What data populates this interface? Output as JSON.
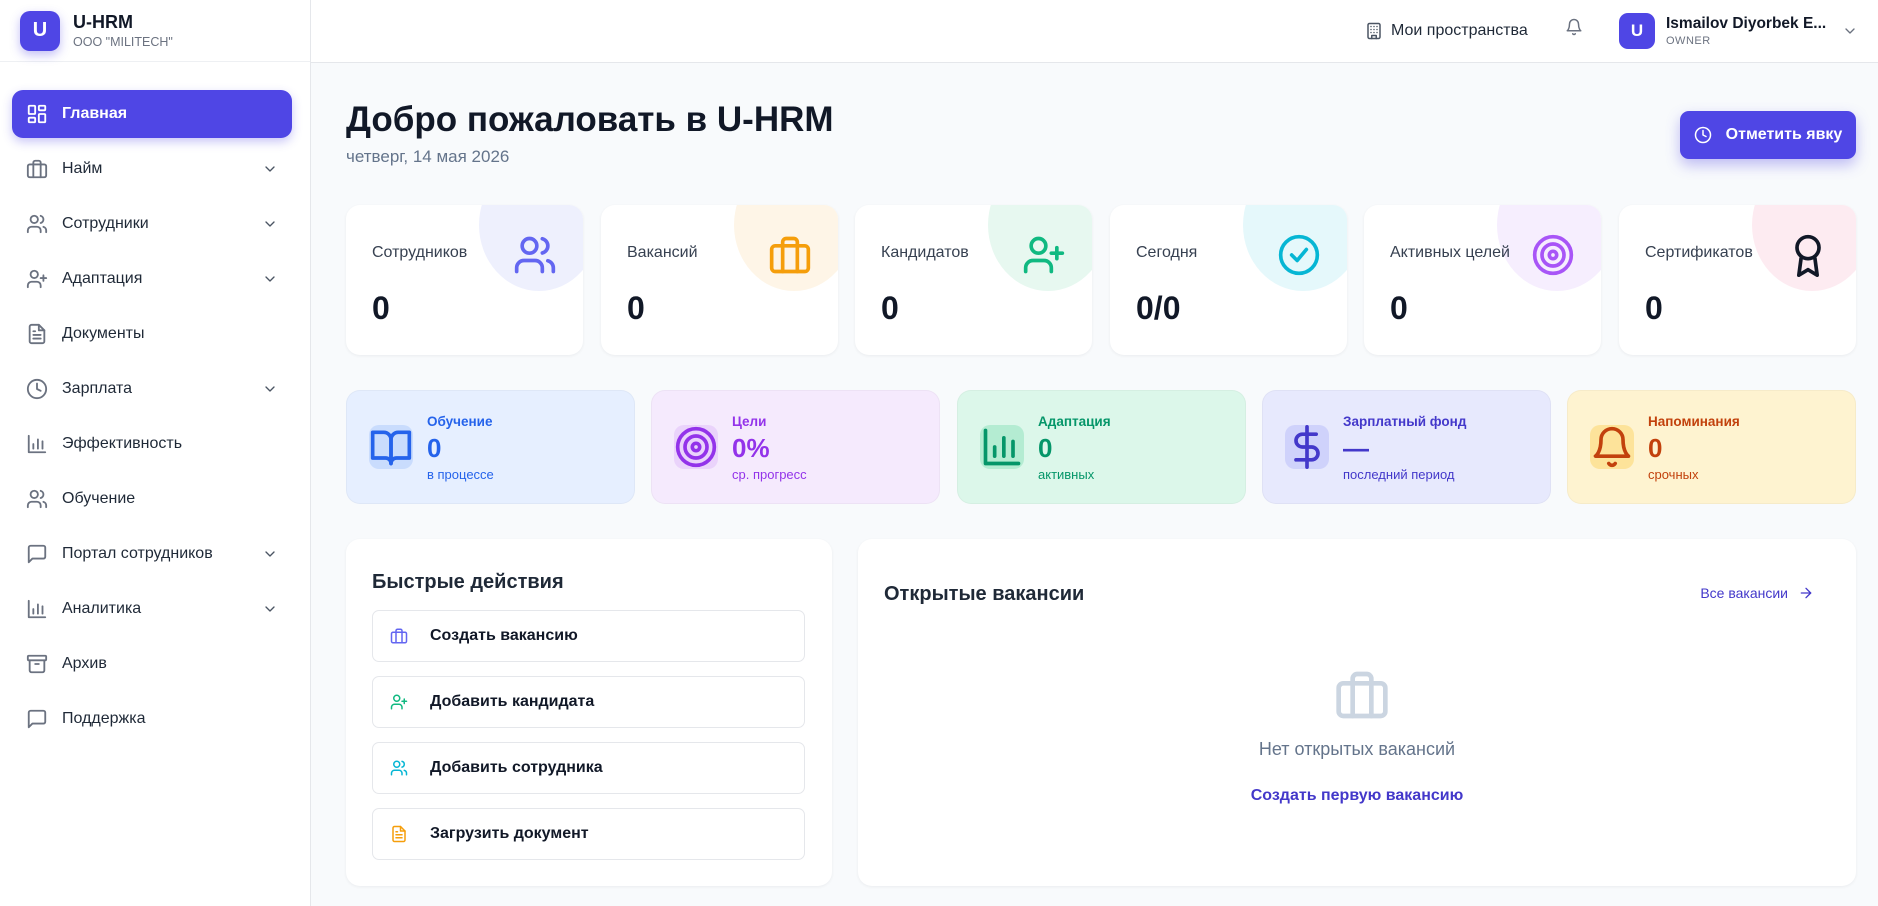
{
  "brand": {
    "logo_letter": "U",
    "name": "U-HRM",
    "org": "ООО \"MILITECH\""
  },
  "sidebar": {
    "items": [
      {
        "label": "Главная",
        "icon": "dashboard-icon",
        "active": true,
        "expandable": false
      },
      {
        "label": "Найм",
        "icon": "briefcase-icon",
        "expandable": true
      },
      {
        "label": "Сотрудники",
        "icon": "users-icon",
        "expandable": true
      },
      {
        "label": "Адаптация",
        "icon": "user-plus-icon",
        "expandable": true
      },
      {
        "label": "Документы",
        "icon": "document-icon",
        "expandable": false
      },
      {
        "label": "Зарплата",
        "icon": "clock-icon",
        "expandable": true
      },
      {
        "label": "Эффективность",
        "icon": "bar-chart-icon",
        "expandable": false
      },
      {
        "label": "Обучение",
        "icon": "users-icon",
        "expandable": false
      },
      {
        "label": "Портал сотрудников",
        "icon": "message-icon",
        "expandable": true
      },
      {
        "label": "Аналитика",
        "icon": "bar-chart-icon",
        "expandable": true
      },
      {
        "label": "Архив",
        "icon": "archive-icon",
        "expandable": false
      },
      {
        "label": "Поддержка",
        "icon": "message-icon",
        "expandable": false
      }
    ]
  },
  "header": {
    "spaces_label": "Мои пространства",
    "user": {
      "avatar_letter": "U",
      "name": "Ismailov Diyorbek E...",
      "role": "OWNER"
    }
  },
  "hero": {
    "title": "Добро пожаловать в U-HRM",
    "date": "четверг, 14 мая 2026",
    "mark_button": "Отметить явку"
  },
  "stats": [
    {
      "label": "Сотрудников",
      "value": "0",
      "icon": "users-icon",
      "color": "#6366f1",
      "tint": "#eef0fd"
    },
    {
      "label": "Вакансий",
      "value": "0",
      "icon": "briefcase-icon",
      "color": "#f59e0b",
      "tint": "#fef5e7"
    },
    {
      "label": "Кандидатов",
      "value": "0",
      "icon": "user-plus-icon",
      "color": "#10b981",
      "tint": "#e7f8f0"
    },
    {
      "label": "Сегодня",
      "value": "0/0",
      "icon": "check-circle-icon",
      "color": "#06b6d4",
      "tint": "#e5f8fb"
    },
    {
      "label": "Активных целей",
      "value": "0",
      "icon": "target-icon",
      "color": "#a855f7",
      "tint": "#f6eefe"
    },
    {
      "label": "Сертификатов",
      "value": "0",
      "icon": "award-icon",
      "color": "#111827",
      "tint": "#fdebf1"
    }
  ],
  "info_cards": [
    {
      "label": "Обучение",
      "value": "0",
      "sub": "в процессе",
      "icon": "book-icon",
      "color": "#2563eb",
      "bg": "#e6efff",
      "icon_bg": "#c9dcfd"
    },
    {
      "label": "Цели",
      "value": "0%",
      "sub": "ср. прогресс",
      "icon": "target-icon",
      "color": "#9333ea",
      "bg": "#f5eafd",
      "icon_bg": "#ead3fb"
    },
    {
      "label": "Адаптация",
      "value": "0",
      "sub": "активных",
      "icon": "bar-chart-icon",
      "color": "#059669",
      "bg": "#dcf7ea",
      "icon_bg": "#b4ecd2"
    },
    {
      "label": "Зарплатный фонд",
      "value": "—",
      "sub": "последний период",
      "icon": "dollar-icon",
      "color": "#4338ca",
      "bg": "#e7e9fd",
      "icon_bg": "#cfd2fb"
    },
    {
      "label": "Напоминания",
      "value": "0",
      "sub": "срочных",
      "icon": "bell-icon",
      "color": "#c2410c",
      "bg": "#fef3d0",
      "icon_bg": "#fde39a"
    }
  ],
  "quick_actions": {
    "title": "Быстрые действия",
    "items": [
      {
        "label": "Создать вакансию",
        "icon": "briefcase-icon",
        "color": "#6366f1"
      },
      {
        "label": "Добавить кандидата",
        "icon": "user-plus-icon",
        "color": "#10b981"
      },
      {
        "label": "Добавить сотрудника",
        "icon": "users-icon",
        "color": "#06b6d4"
      },
      {
        "label": "Загрузить документ",
        "icon": "document-icon",
        "color": "#f59e0b"
      }
    ]
  },
  "vacancies": {
    "title": "Открытые вакансии",
    "all_link": "Все вакансии",
    "empty_text": "Нет открытых вакансий",
    "create_link": "Создать первую вакансию"
  }
}
